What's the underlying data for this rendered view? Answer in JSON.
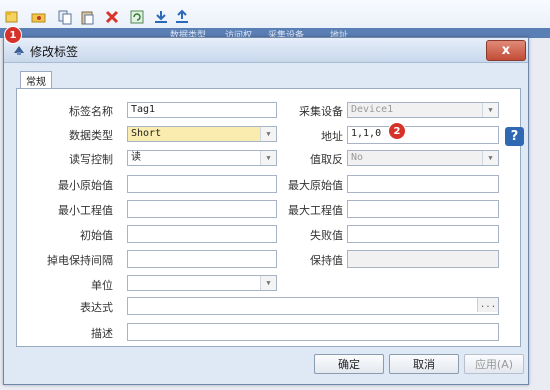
{
  "toolbar": {
    "icons": [
      "new-icon",
      "open-icon",
      "copy-icon",
      "paste-icon",
      "delete-icon",
      "refresh-icon",
      "import-icon",
      "export-icon"
    ]
  },
  "background": {
    "headers": [
      "数据类型",
      "访问权",
      "采集设备",
      "地址"
    ]
  },
  "dialog": {
    "title": "修改标签",
    "close": "x",
    "tab": "常规",
    "help": "?"
  },
  "fields": {
    "tag_name": {
      "label": "标签名称",
      "value": "Tag1"
    },
    "data_type": {
      "label": "数据类型",
      "value": "Short"
    },
    "rw_control": {
      "label": "读写控制",
      "value": "读"
    },
    "raw_min": {
      "label": "最小原始值",
      "value": ""
    },
    "eng_min": {
      "label": "最小工程值",
      "value": ""
    },
    "initial": {
      "label": "初始值",
      "value": ""
    },
    "power_hold": {
      "label": "掉电保持间隔",
      "value": ""
    },
    "unit": {
      "label": "单位",
      "value": ""
    },
    "expression": {
      "label": "表达式",
      "value": "",
      "button": "..."
    },
    "description": {
      "label": "描述",
      "value": ""
    },
    "device": {
      "label": "采集设备",
      "value": "Device1"
    },
    "address": {
      "label": "地址",
      "value": "1,1,0"
    },
    "invert": {
      "label": "值取反",
      "value": "No"
    },
    "raw_max": {
      "label": "最大原始值",
      "value": ""
    },
    "eng_max": {
      "label": "最大工程值",
      "value": ""
    },
    "fail": {
      "label": "失败值",
      "value": ""
    },
    "hold": {
      "label": "保持值",
      "value": ""
    }
  },
  "buttons": {
    "ok": "确定",
    "cancel": "取消",
    "apply": "应用(A)"
  },
  "badges": [
    "1",
    "2"
  ]
}
